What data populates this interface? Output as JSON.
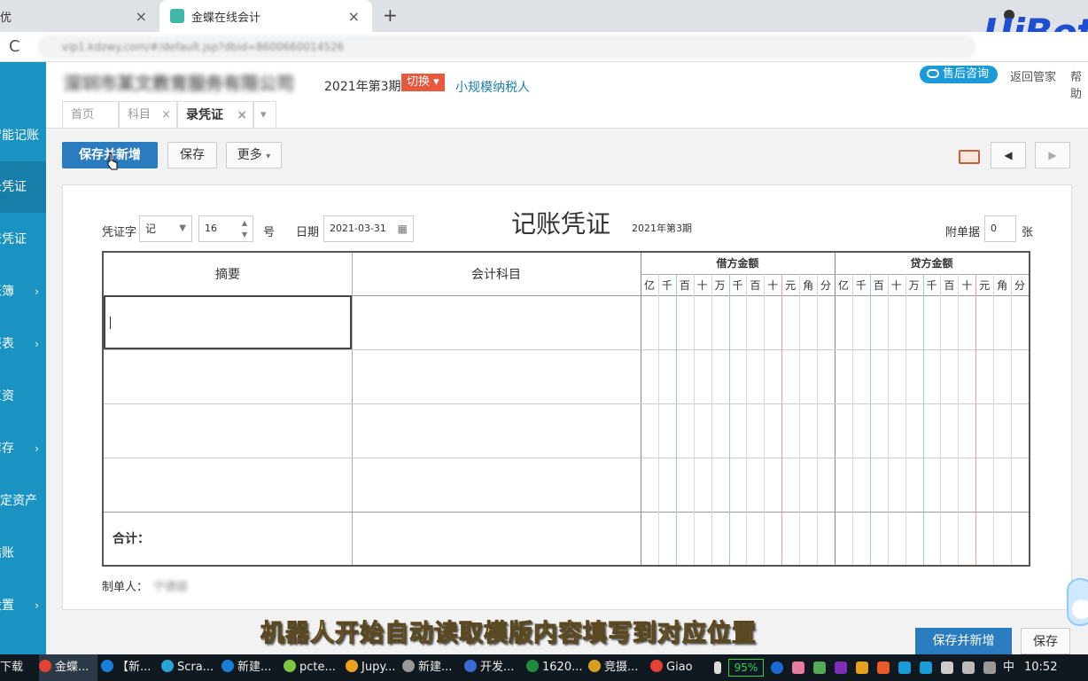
{
  "browser": {
    "prev_tab_fragment": "优",
    "active_tab_title": "金蝶在线会计",
    "close_glyph": "×",
    "new_tab_glyph": "+",
    "url": "vip1.kdzwy.com/#/default.jsp?dbid=8600660014526",
    "reload_glyph": "C",
    "overlay_logo": "UiBot"
  },
  "sidebar": {
    "items": [
      {
        "label": "智能记账",
        "arrow": ""
      },
      {
        "label": "录凭证",
        "arrow": ""
      },
      {
        "label": "查凭证",
        "arrow": ""
      },
      {
        "label": "账簿",
        "arrow": "›"
      },
      {
        "label": "报表",
        "arrow": "›"
      },
      {
        "label": "工资",
        "arrow": ""
      },
      {
        "label": "库存",
        "arrow": "›"
      },
      {
        "label": "固定资产",
        "arrow": ""
      },
      {
        "label": "结账",
        "arrow": ""
      },
      {
        "label": "设置",
        "arrow": "›"
      }
    ]
  },
  "header": {
    "company": "深圳市某文教育服务有限公司",
    "period": "2021年第3期",
    "switch_label": "切换",
    "switch_arrow": "▾",
    "tax_type": "小规模纳税人",
    "consult_label": "售后咨询",
    "back_label": "返回管家",
    "help_label": "帮助"
  },
  "page_tabs": {
    "home": "首页",
    "subject": "科目",
    "current": "录凭证",
    "close_glyph": "×",
    "more_glyph": "▾"
  },
  "toolbar": {
    "save_new": "保存并新增",
    "save": "保存",
    "more": "更多",
    "more_arrow": "▾",
    "prev_glyph": "◀",
    "next_glyph": "▶"
  },
  "voucher": {
    "word_label": "凭证字",
    "word_value": "记",
    "number_value": "16",
    "number_unit": "号",
    "date_label": "日期",
    "date_value": "2021-03-31",
    "title": "记账凭证",
    "period": "2021年第3期",
    "attach_label": "附单据",
    "attach_value": "0",
    "attach_unit": "张",
    "col_summary": "摘要",
    "col_account": "会计科目",
    "col_debit": "借方金额",
    "col_credit": "贷方金额",
    "digits": [
      "亿",
      "千",
      "百",
      "十",
      "万",
      "千",
      "百",
      "十",
      "元",
      "角",
      "分"
    ],
    "total_label": "合计：",
    "maker_label": "制单人：",
    "maker_name": "宁德丽"
  },
  "caption": "机器人开始自动读取模版内容填写到对应位置",
  "footer": {
    "save_new": "保存并新增",
    "save": "保存"
  },
  "taskbar": {
    "items": [
      "下载",
      "金蝶...",
      "【新...",
      "Scra...",
      "新建...",
      "pcte...",
      "Jupy...",
      "新建...",
      "开发...",
      "1620...",
      "竞摄...",
      "Giao"
    ],
    "battery": "95%",
    "ime": "中",
    "time": "10:52"
  },
  "colors": {
    "sidebar": "#1a92c2",
    "primary_button": "#2a7cbf",
    "switch_badge": "#e8583c",
    "caption": "#e8c77a"
  }
}
